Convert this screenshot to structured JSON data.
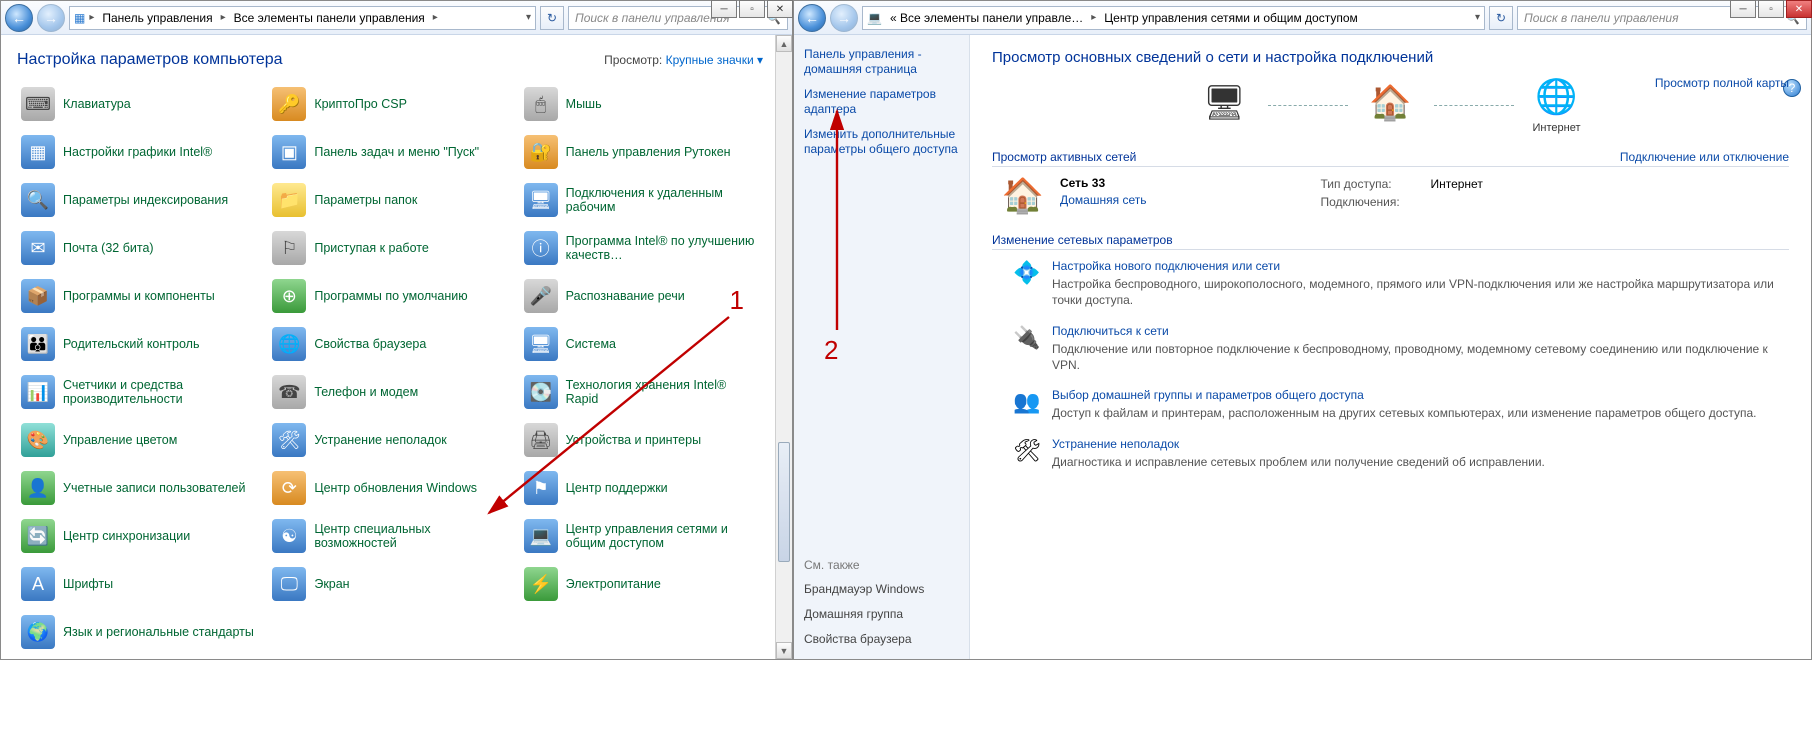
{
  "left": {
    "titlebar": {
      "min": "─",
      "max": "▫",
      "close": "✕"
    },
    "toolbar": {
      "back": "←",
      "fwd": "→",
      "crumbs": [
        "Панель управления",
        "Все элементы панели управления"
      ],
      "refresh": "↻",
      "search_placeholder": "Поиск в панели управления"
    },
    "header": {
      "title": "Настройка параметров компьютера",
      "view_label": "Просмотр:",
      "view_value": "Крупные значки ▾"
    },
    "items": [
      {
        "label": "Клавиатура",
        "ic": "⌨",
        "cls": "ic-gray"
      },
      {
        "label": "КриптоПро CSP",
        "ic": "🔑",
        "cls": "ic-orange"
      },
      {
        "label": "Мышь",
        "ic": "🖱",
        "cls": "ic-gray"
      },
      {
        "label": "Настройки графики Intel®",
        "ic": "▦",
        "cls": "ic-blue"
      },
      {
        "label": "Панель задач и меню \"Пуск\"",
        "ic": "▣",
        "cls": "ic-blue"
      },
      {
        "label": "Панель управления Рутокен",
        "ic": "🔐",
        "cls": "ic-orange"
      },
      {
        "label": "Параметры индексирования",
        "ic": "🔍",
        "cls": "ic-blue"
      },
      {
        "label": "Параметры папок",
        "ic": "📁",
        "cls": "ic-yellow"
      },
      {
        "label": "Подключения к удаленным рабочим",
        "ic": "🖥",
        "cls": "ic-blue"
      },
      {
        "label": "Почта (32 бита)",
        "ic": "✉",
        "cls": "ic-blue"
      },
      {
        "label": "Приступая к работе",
        "ic": "⚐",
        "cls": "ic-gray"
      },
      {
        "label": "Программа Intel® по улучшению качеств…",
        "ic": "ⓘ",
        "cls": "ic-blue"
      },
      {
        "label": "Программы и компоненты",
        "ic": "📦",
        "cls": "ic-blue"
      },
      {
        "label": "Программы по умолчанию",
        "ic": "⊕",
        "cls": "ic-green"
      },
      {
        "label": "Распознавание речи",
        "ic": "🎤",
        "cls": "ic-gray"
      },
      {
        "label": "Родительский контроль",
        "ic": "👪",
        "cls": "ic-blue"
      },
      {
        "label": "Свойства браузера",
        "ic": "🌐",
        "cls": "ic-blue"
      },
      {
        "label": "Система",
        "ic": "🖥",
        "cls": "ic-blue"
      },
      {
        "label": "Счетчики и средства производительности",
        "ic": "📊",
        "cls": "ic-blue"
      },
      {
        "label": "Телефон и модем",
        "ic": "☎",
        "cls": "ic-gray"
      },
      {
        "label": "Технология хранения Intel® Rapid",
        "ic": "💽",
        "cls": "ic-blue"
      },
      {
        "label": "Управление цветом",
        "ic": "🎨",
        "cls": "ic-teal"
      },
      {
        "label": "Устранение неполадок",
        "ic": "🛠",
        "cls": "ic-blue"
      },
      {
        "label": "Устройства и принтеры",
        "ic": "🖨",
        "cls": "ic-gray"
      },
      {
        "label": "Учетные записи пользователей",
        "ic": "👤",
        "cls": "ic-green"
      },
      {
        "label": "Центр обновления Windows",
        "ic": "⟳",
        "cls": "ic-orange"
      },
      {
        "label": "Центр поддержки",
        "ic": "⚑",
        "cls": "ic-blue"
      },
      {
        "label": "Центр синхронизации",
        "ic": "🔄",
        "cls": "ic-green"
      },
      {
        "label": "Центр специальных возможностей",
        "ic": "☯",
        "cls": "ic-blue"
      },
      {
        "label": "Центр управления сетями и общим доступом",
        "ic": "💻",
        "cls": "ic-blue"
      },
      {
        "label": "Шрифты",
        "ic": "A",
        "cls": "ic-blue"
      },
      {
        "label": "Экран",
        "ic": "🖵",
        "cls": "ic-blue"
      },
      {
        "label": "Электропитание",
        "ic": "⚡",
        "cls": "ic-green"
      },
      {
        "label": "Язык и региональные стандарты",
        "ic": "🌍",
        "cls": "ic-blue"
      }
    ],
    "annotation": "1"
  },
  "right": {
    "titlebar": {
      "min": "─",
      "max": "▫",
      "close": "✕"
    },
    "toolbar": {
      "back": "←",
      "fwd": "→",
      "crumbs": [
        "« Все элементы панели управле…",
        "Центр управления сетями и общим доступом"
      ],
      "refresh": "↻",
      "search_placeholder": "Поиск в панели управления"
    },
    "side": {
      "home": "Панель управления - домашняя страница",
      "links": [
        "Изменение параметров адаптера",
        "Изменить дополнительные параметры общего доступа"
      ],
      "seealso_hdr": "См. также",
      "seealso": [
        "Брандмауэр Windows",
        "Домашняя группа",
        "Свойства браузера"
      ]
    },
    "main": {
      "title": "Просмотр основных сведений о сети и настройка подключений",
      "map_full_link": "Просмотр полной карты",
      "nodes": [
        {
          "ic": "🖥",
          "label": ""
        },
        {
          "ic": "🏠",
          "label": ""
        },
        {
          "ic": "🌐",
          "label": "Интернет"
        }
      ],
      "active_hdr": "Просмотр активных сетей",
      "active_right": "Подключение или отключение",
      "network": {
        "name": "Сеть 33",
        "category": "Домашняя сеть",
        "access_lbl": "Тип доступа:",
        "access_val": "Интернет",
        "conn_lbl": "Подключения:"
      },
      "change_hdr": "Изменение сетевых параметров",
      "tasks": [
        {
          "ic": "💠",
          "title": "Настройка нового подключения или сети",
          "desc": "Настройка беспроводного, широкополосного, модемного, прямого или VPN-подключения или же настройка маршрутизатора или точки доступа."
        },
        {
          "ic": "🔌",
          "title": "Подключиться к сети",
          "desc": "Подключение или повторное подключение к беспроводному, проводному, модемному сетевому соединению или подключение к VPN."
        },
        {
          "ic": "👥",
          "title": "Выбор домашней группы и параметров общего доступа",
          "desc": "Доступ к файлам и принтерам, расположенным на других сетевых компьютерах, или изменение параметров общего доступа."
        },
        {
          "ic": "🛠",
          "title": "Устранение неполадок",
          "desc": "Диагностика и исправление сетевых проблем или получение сведений об исправлении."
        }
      ],
      "help": "?"
    },
    "annotation": "2"
  }
}
